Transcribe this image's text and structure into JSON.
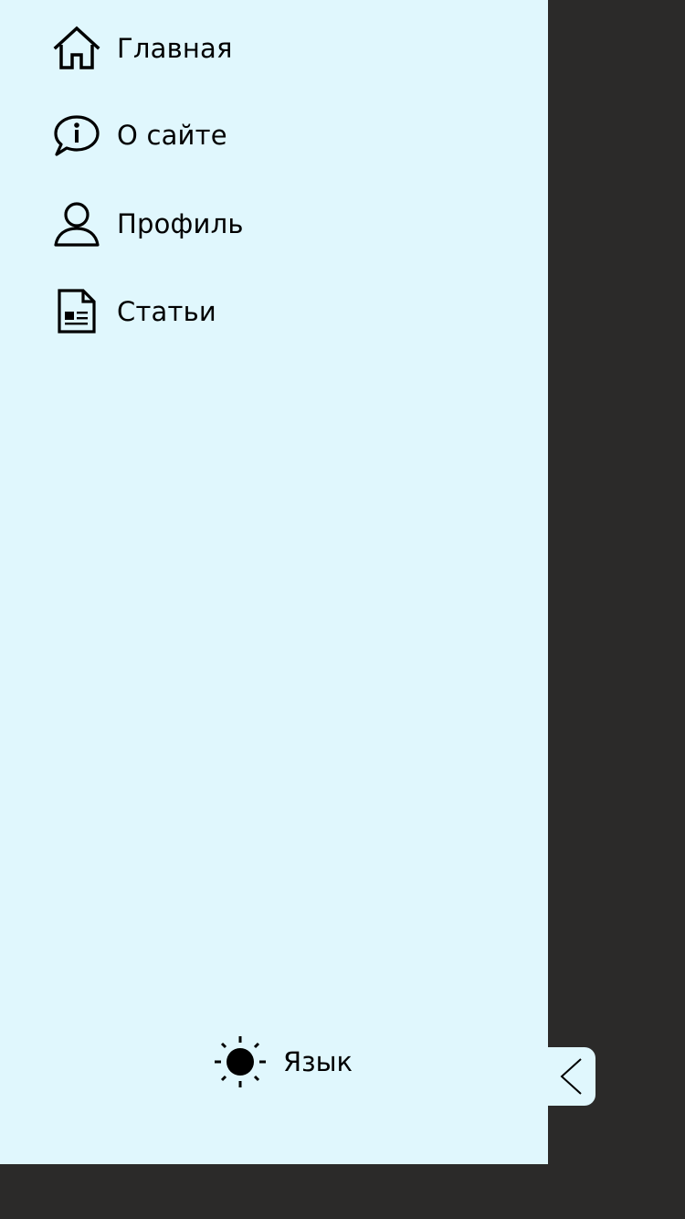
{
  "sidebar": {
    "items": [
      {
        "label": "Главная",
        "icon": "home-icon"
      },
      {
        "label": "О сайте",
        "icon": "info-chat-icon"
      },
      {
        "label": "Профиль",
        "icon": "user-icon"
      },
      {
        "label": "Статьи",
        "icon": "article-icon"
      }
    ],
    "footer": {
      "theme_icon": "sun-icon",
      "language_label": "Язык"
    },
    "collapse_icon": "chevron-left-icon"
  },
  "colors": {
    "sidebar_background": "#e0f7fd",
    "page_background": "#2b2a29",
    "text": "#000000"
  }
}
